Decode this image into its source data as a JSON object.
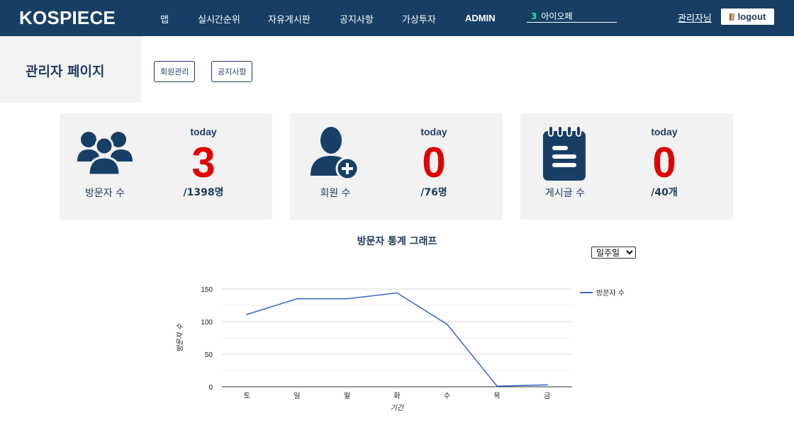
{
  "header": {
    "logo": "KOSPIECE",
    "nav": [
      "맵",
      "실시간순위",
      "자유게시판",
      "공지사항",
      "가상투자",
      "ADMIN"
    ],
    "ticker": {
      "rank": "3",
      "name": "아이오페"
    },
    "user": "관리자님",
    "logout": "logout"
  },
  "admin": {
    "title": "관리자 페이지",
    "buttons": [
      "회원관리",
      "공지사항"
    ]
  },
  "cards": [
    {
      "icon": "users-group-icon",
      "label": "방문자 수",
      "today_label": "today",
      "today_value": "3",
      "total": "/1398명"
    },
    {
      "icon": "user-add-icon",
      "label": "회원 수",
      "today_label": "today",
      "today_value": "0",
      "total": "/76명"
    },
    {
      "icon": "notepad-icon",
      "label": "게시글 수",
      "today_label": "today",
      "today_value": "0",
      "total": "/40개"
    }
  ],
  "chart": {
    "title": "방문자 통계 그래프",
    "period_options": [
      "일주일"
    ],
    "period_selected": "일주일"
  },
  "chart_data": {
    "type": "line",
    "categories": [
      "토",
      "일",
      "월",
      "화",
      "수",
      "목",
      "금"
    ],
    "series": [
      {
        "name": "방문자 수",
        "values": [
          111,
          135,
          135,
          144,
          96,
          1,
          3
        ],
        "color": "#3366cc"
      }
    ],
    "xlabel": "기간",
    "ylabel": "방문자 수",
    "ylim": [
      0,
      150
    ],
    "yticks": [
      0,
      50,
      100,
      150
    ],
    "grid": true,
    "legend": "right"
  },
  "colors": {
    "header_bg": "#173f66",
    "accent_red": "#e00000",
    "text_navy": "#1e3a5f",
    "card_bg": "#f2f2f2"
  }
}
